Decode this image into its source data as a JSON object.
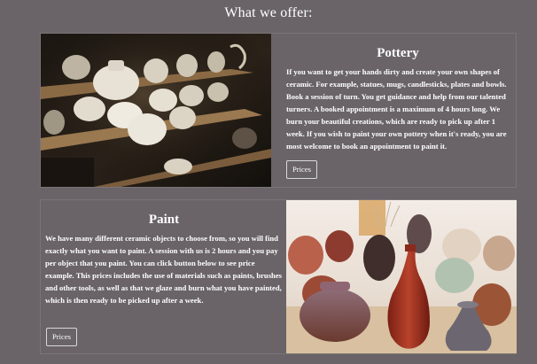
{
  "section": {
    "title": "What we offer:"
  },
  "pottery": {
    "title": "Pottery",
    "text": "If you want to get your hands dirty and create your own shapes of ceramic. For example, statues, mugs, candlesticks, plates and bowls. Book a session of turn. You get guidance and help from our talented turners. A booked appointment is a maximum of 4 hours long. We burn your beautiful creations, which are ready to pick up after 1 week. If you wish to paint your own pottery when it's ready, you are most welcome to book an appointment to paint it.",
    "button_label": "Prices"
  },
  "paint": {
    "title": "Paint",
    "text": "We have many different ceramic objects to choose from, so you will find exactly what you want to paint. A session with us is 2 hours and you pay per object that you paint. You can click button below to see price example. This prices includes the use of materials such as paints, brushes and other tools, as well as that we glaze and burn what you have painted, which is then ready to be picked up after a week.",
    "button_label": "Prices"
  }
}
